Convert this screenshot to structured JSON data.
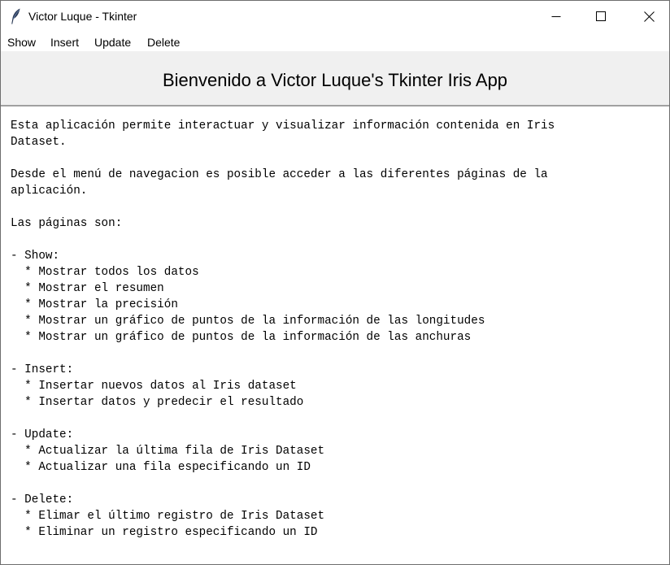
{
  "window": {
    "title": "Victor Luque - Tkinter",
    "icon": "feather-icon"
  },
  "menu": {
    "items": [
      "Show",
      "Insert",
      "Update",
      "Delete"
    ]
  },
  "banner": {
    "title": "Bienvenido a Victor Luque's Tkinter Iris App"
  },
  "content": {
    "lines": [
      "Esta aplicación permite interactuar y visualizar información contenida en Iris",
      "Dataset.",
      "",
      "Desde el menú de navegacion es posible acceder a las diferentes páginas de la",
      "aplicación.",
      "",
      "Las páginas son:",
      "",
      "- Show:",
      "  * Mostrar todos los datos",
      "  * Mostrar el resumen",
      "  * Mostrar la precisión",
      "  * Mostrar un gráfico de puntos de la información de las longitudes",
      "  * Mostrar un gráfico de puntos de la información de las anchuras",
      "",
      "- Insert:",
      "  * Insertar nuevos datos al Iris dataset",
      "  * Insertar datos y predecir el resultado",
      "",
      "- Update:",
      "  * Actualizar la última fila de Iris Dataset",
      "  * Actualizar una fila especificando un ID",
      "",
      "- Delete:",
      "  * Elimar el último registro de Iris Dataset",
      "  * Eliminar un registro especificando un ID"
    ]
  }
}
